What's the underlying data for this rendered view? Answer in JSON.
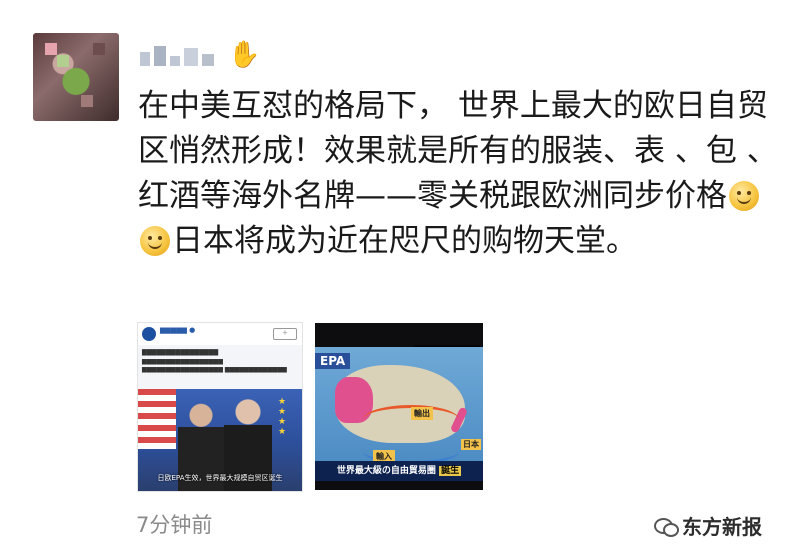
{
  "post": {
    "text": "在中美互怼的格局下， 世界上最大的欧日自贸区悄然形成！效果就是所有的服装、表 、包 、红酒等海外名牌——零关税跟欧洲同步价格",
    "text_after_emoji": "日本将成为近在咫尺的购物天堂。",
    "emoji": [
      "smile-emoji",
      "smile-emoji"
    ],
    "time": "7分钟前"
  },
  "images": [
    {
      "caption": "日欧EPA生效，世界最大规模自贸区诞生"
    },
    {
      "label_epa": "EPA",
      "label_out": "輸出",
      "label_in": "輸入",
      "label_jp": "日本",
      "caption_main": "世界最大級の自由貿易圏",
      "caption_highlight": "誕生"
    }
  ],
  "watermark": {
    "text": "东方新报"
  }
}
